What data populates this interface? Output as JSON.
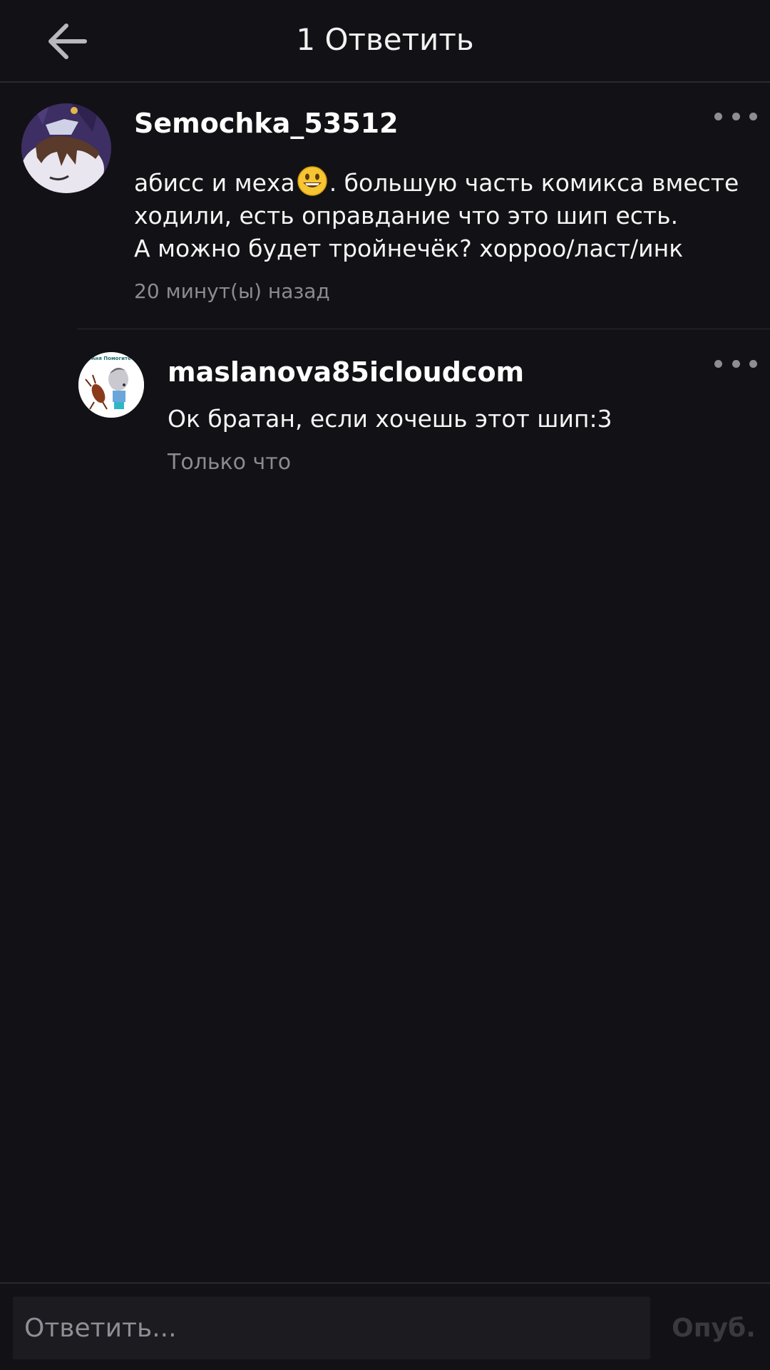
{
  "header": {
    "title": "1 Ответить",
    "back_icon": "arrow-left-icon"
  },
  "comment": {
    "username": "Semochka_53512",
    "text_before_emoji": "абисс и меха",
    "emoji": "grinning-face-emoji",
    "text_after_emoji": ". большую часть комикса вместе",
    "text_line2": "ходили, есть оправдание что это шип есть.",
    "text_line3": "А можно будет тройнечёк? хорроо/ласт/инк",
    "time": "20 минут(ы) назад",
    "more_icon": "more-dots-icon"
  },
  "reply": {
    "username": "maslanova85icloudcom",
    "text": "Ок братан, если хочешь этот шип:3",
    "time": "Только что",
    "avatar_text": "Аня Помогите",
    "more_icon": "more-dots-icon"
  },
  "composer": {
    "placeholder": "Ответить...",
    "value": "",
    "publish_label": "Опуб."
  },
  "colors": {
    "background": "#121115",
    "divider": "#2a292e",
    "secondary_text": "#8c8b90"
  }
}
